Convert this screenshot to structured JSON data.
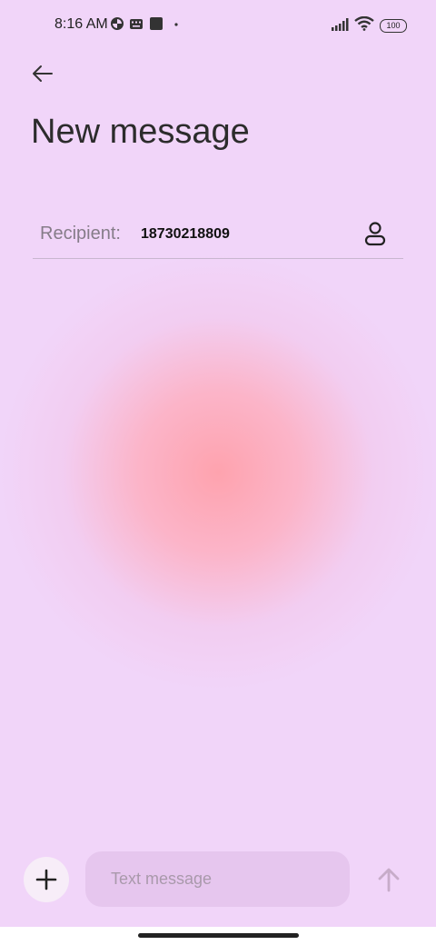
{
  "status_bar": {
    "time": "8:16 AM",
    "battery": "100",
    "icons": [
      "pinwheel-icon",
      "keyboard-icon",
      "square-icon",
      "dot-icon",
      "signal-icon",
      "wifi-icon",
      "battery-icon"
    ]
  },
  "header": {
    "back_icon": "arrow-left-icon",
    "title": "New message"
  },
  "recipient": {
    "label": "Recipient:",
    "value": "18730218809",
    "contact_icon": "person-icon"
  },
  "composer": {
    "add_icon": "plus-icon",
    "placeholder": "Text message",
    "value": "",
    "send_icon": "arrow-up-icon"
  },
  "colors": {
    "background": "#f1d5f9",
    "blob": "#ffa6b0",
    "input_bg": "#e6c6ee"
  }
}
